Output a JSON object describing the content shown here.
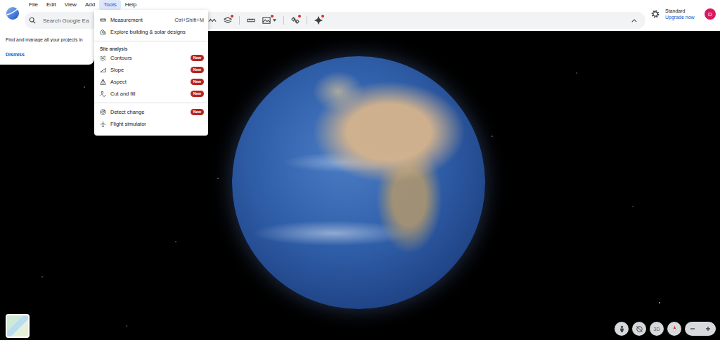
{
  "menubar": [
    {
      "label": "File",
      "selected": false
    },
    {
      "label": "Edit",
      "selected": false
    },
    {
      "label": "View",
      "selected": false
    },
    {
      "label": "Add",
      "selected": false
    },
    {
      "label": "Tools",
      "selected": true
    },
    {
      "label": "Help",
      "selected": false
    }
  ],
  "search": {
    "placeholder": "Search Google Ea"
  },
  "toolbar": [
    {
      "badge": false
    },
    {
      "badge": true
    },
    {
      "badge": false
    },
    {
      "badge": true
    },
    {
      "badge": true
    },
    {
      "badge": true
    }
  ],
  "account": {
    "plan": "Standard",
    "upgrade": "Upgrade now",
    "initial": "D"
  },
  "notice": {
    "text": "Find and manage all your projects in",
    "action": "Dismiss"
  },
  "tools_menu": {
    "groups": [
      {
        "items": [
          {
            "label": "Measurement",
            "shortcut": "Ctrl+Shift+M"
          },
          {
            "label": "Explore building & solar designs"
          }
        ]
      },
      {
        "heading": "Site analysis",
        "items": [
          {
            "label": "Contours",
            "badge": "New"
          },
          {
            "label": "Slope",
            "badge": "New"
          },
          {
            "label": "Aspect",
            "badge": "New"
          },
          {
            "label": "Cut and fill",
            "badge": "New"
          }
        ]
      },
      {
        "items": [
          {
            "label": "Detect change",
            "badge": "New"
          },
          {
            "label": "Flight simulator"
          }
        ]
      }
    ]
  },
  "map_controls": {
    "view_mode": "3D"
  }
}
